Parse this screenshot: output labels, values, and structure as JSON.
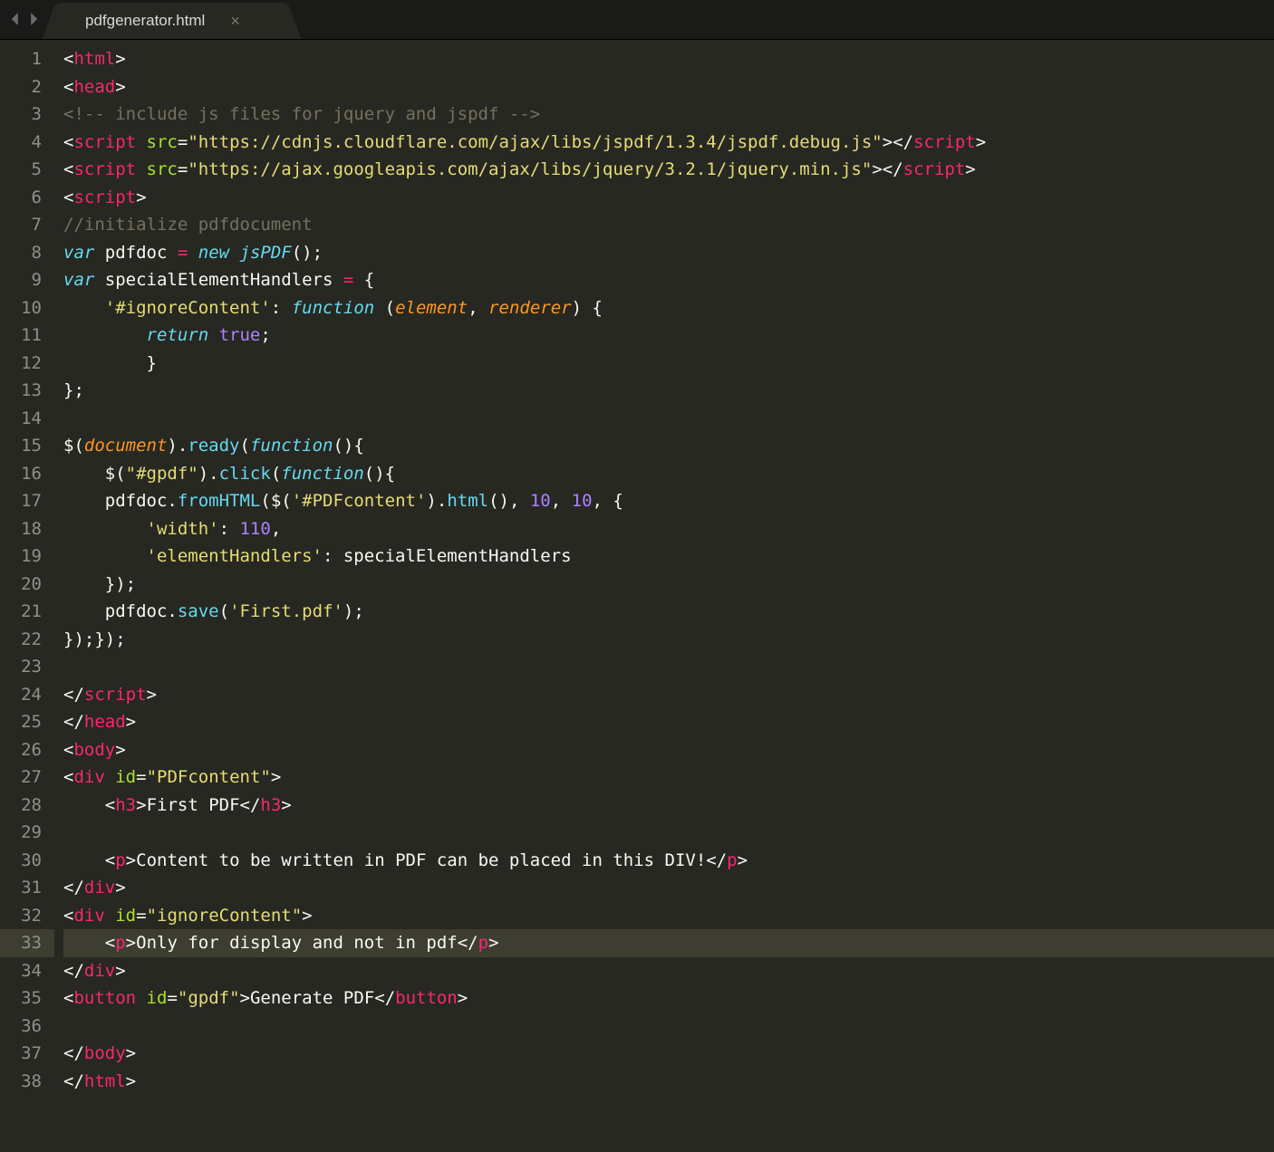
{
  "tab": {
    "filename": "pdfgenerator.html",
    "close": "×"
  },
  "nav": {
    "back": "◀",
    "forward": "▶"
  },
  "active_line": 33,
  "line_count": 38,
  "code": {
    "l1": [
      [
        "tagp",
        "<"
      ],
      [
        "tag",
        "html"
      ],
      [
        "tagp",
        ">"
      ]
    ],
    "l2": [
      [
        "tagp",
        "<"
      ],
      [
        "tag",
        "head"
      ],
      [
        "tagp",
        ">"
      ]
    ],
    "l3": [
      [
        "cmt",
        "<!-- include js files for jquery and jspdf -->"
      ]
    ],
    "l4": [
      [
        "tagp",
        "<"
      ],
      [
        "tag",
        "script"
      ],
      [
        "txt",
        " "
      ],
      [
        "attr",
        "src"
      ],
      [
        "pun",
        "="
      ],
      [
        "str",
        "\"https://cdnjs.cloudflare.com/ajax/libs/jspdf/1.3.4/jspdf.debug.js\""
      ],
      [
        "tagp",
        "></"
      ],
      [
        "tag",
        "script"
      ],
      [
        "tagp",
        ">"
      ]
    ],
    "l5": [
      [
        "tagp",
        "<"
      ],
      [
        "tag",
        "script"
      ],
      [
        "txt",
        " "
      ],
      [
        "attr",
        "src"
      ],
      [
        "pun",
        "="
      ],
      [
        "str",
        "\"https://ajax.googleapis.com/ajax/libs/jquery/3.2.1/jquery.min.js\""
      ],
      [
        "tagp",
        "></"
      ],
      [
        "tag",
        "script"
      ],
      [
        "tagp",
        ">"
      ]
    ],
    "l6": [
      [
        "tagp",
        "<"
      ],
      [
        "tag",
        "script"
      ],
      [
        "tagp",
        ">"
      ]
    ],
    "l7": [
      [
        "cmt",
        "//initialize pdfdocument"
      ]
    ],
    "l8": [
      [
        "stor",
        "var"
      ],
      [
        "txt",
        " pdfdoc "
      ],
      [
        "kw",
        "="
      ],
      [
        "txt",
        " "
      ],
      [
        "stor",
        "new"
      ],
      [
        "txt",
        " "
      ],
      [
        "type",
        "jsPDF"
      ],
      [
        "pun",
        "();"
      ]
    ],
    "l9": [
      [
        "stor",
        "var"
      ],
      [
        "txt",
        " specialElementHandlers "
      ],
      [
        "kw",
        "="
      ],
      [
        "txt",
        " {"
      ]
    ],
    "l10": [
      [
        "txt",
        "    "
      ],
      [
        "str",
        "'#ignoreContent'"
      ],
      [
        "pun",
        ": "
      ],
      [
        "stor",
        "function"
      ],
      [
        "txt",
        " "
      ],
      [
        "pun",
        "("
      ],
      [
        "param",
        "element"
      ],
      [
        "pun",
        ", "
      ],
      [
        "param",
        "renderer"
      ],
      [
        "pun",
        ")"
      ],
      [
        "txt",
        " {"
      ]
    ],
    "l11": [
      [
        "txt",
        "        "
      ],
      [
        "stor",
        "return"
      ],
      [
        "txt",
        " "
      ],
      [
        "bool",
        "true"
      ],
      [
        "pun",
        ";"
      ]
    ],
    "l12": [
      [
        "txt",
        "        }"
      ]
    ],
    "l13": [
      [
        "txt",
        "};"
      ]
    ],
    "l14": [],
    "l15": [
      [
        "txt",
        "$("
      ],
      [
        "param",
        "document"
      ],
      [
        "txt",
        ")."
      ],
      [
        "call",
        "ready"
      ],
      [
        "pun",
        "("
      ],
      [
        "stor",
        "function"
      ],
      [
        "pun",
        "(){"
      ]
    ],
    "l16": [
      [
        "txt",
        "    $("
      ],
      [
        "str",
        "\"#gpdf\""
      ],
      [
        "txt",
        ")."
      ],
      [
        "call",
        "click"
      ],
      [
        "pun",
        "("
      ],
      [
        "stor",
        "function"
      ],
      [
        "pun",
        "(){"
      ]
    ],
    "l17": [
      [
        "txt",
        "    pdfdoc."
      ],
      [
        "call",
        "fromHTML"
      ],
      [
        "pun",
        "("
      ],
      [
        "txt",
        "$("
      ],
      [
        "str",
        "'#PDFcontent'"
      ],
      [
        "txt",
        ")."
      ],
      [
        "call",
        "html"
      ],
      [
        "pun",
        "(), "
      ],
      [
        "num",
        "10"
      ],
      [
        "pun",
        ", "
      ],
      [
        "num",
        "10"
      ],
      [
        "pun",
        ", {"
      ]
    ],
    "l18": [
      [
        "txt",
        "        "
      ],
      [
        "str",
        "'width'"
      ],
      [
        "pun",
        ": "
      ],
      [
        "num",
        "110"
      ],
      [
        "pun",
        ","
      ]
    ],
    "l19": [
      [
        "txt",
        "        "
      ],
      [
        "str",
        "'elementHandlers'"
      ],
      [
        "pun",
        ": specialElementHandlers"
      ]
    ],
    "l20": [
      [
        "txt",
        "    });"
      ]
    ],
    "l21": [
      [
        "txt",
        "    pdfdoc."
      ],
      [
        "call",
        "save"
      ],
      [
        "pun",
        "("
      ],
      [
        "str",
        "'First.pdf'"
      ],
      [
        "pun",
        ");"
      ]
    ],
    "l22": [
      [
        "txt",
        "});});"
      ]
    ],
    "l23": [],
    "l24": [
      [
        "tagp",
        "</"
      ],
      [
        "tag",
        "script"
      ],
      [
        "tagp",
        ">"
      ]
    ],
    "l25": [
      [
        "tagp",
        "</"
      ],
      [
        "tag",
        "head"
      ],
      [
        "tagp",
        ">"
      ]
    ],
    "l26": [
      [
        "tagp",
        "<"
      ],
      [
        "tag",
        "body"
      ],
      [
        "tagp",
        ">"
      ]
    ],
    "l27": [
      [
        "tagp",
        "<"
      ],
      [
        "tag",
        "div"
      ],
      [
        "txt",
        " "
      ],
      [
        "attr",
        "id"
      ],
      [
        "pun",
        "="
      ],
      [
        "str",
        "\"PDFcontent\""
      ],
      [
        "tagp",
        ">"
      ]
    ],
    "l28": [
      [
        "txt",
        "    "
      ],
      [
        "tagp",
        "<"
      ],
      [
        "tag",
        "h3"
      ],
      [
        "tagp",
        ">"
      ],
      [
        "txt",
        "First PDF"
      ],
      [
        "tagp",
        "</"
      ],
      [
        "tag",
        "h3"
      ],
      [
        "tagp",
        ">"
      ]
    ],
    "l29": [],
    "l30": [
      [
        "txt",
        "    "
      ],
      [
        "tagp",
        "<"
      ],
      [
        "tag",
        "p"
      ],
      [
        "tagp",
        ">"
      ],
      [
        "txt",
        "Content to be written in PDF can be placed in this DIV!"
      ],
      [
        "tagp",
        "</"
      ],
      [
        "tag",
        "p"
      ],
      [
        "tagp",
        ">"
      ]
    ],
    "l31": [
      [
        "tagp",
        "</"
      ],
      [
        "tag",
        "div"
      ],
      [
        "tagp",
        ">"
      ]
    ],
    "l32": [
      [
        "tagp",
        "<"
      ],
      [
        "tag",
        "div"
      ],
      [
        "txt",
        " "
      ],
      [
        "attr",
        "id"
      ],
      [
        "pun",
        "="
      ],
      [
        "str",
        "\"ignoreContent\""
      ],
      [
        "tagp",
        ">"
      ]
    ],
    "l33": [
      [
        "txt",
        "    "
      ],
      [
        "tagp",
        "<"
      ],
      [
        "tag",
        "p"
      ],
      [
        "tagp",
        ">"
      ],
      [
        "txt",
        "Only for display and not in pdf"
      ],
      [
        "tagp",
        "</"
      ],
      [
        "tag",
        "p"
      ],
      [
        "tagp",
        ">"
      ]
    ],
    "l34": [
      [
        "tagp",
        "</"
      ],
      [
        "tag",
        "div"
      ],
      [
        "tagp",
        ">"
      ]
    ],
    "l35": [
      [
        "tagp",
        "<"
      ],
      [
        "tag",
        "button"
      ],
      [
        "txt",
        " "
      ],
      [
        "attr",
        "id"
      ],
      [
        "pun",
        "="
      ],
      [
        "str",
        "\"gpdf\""
      ],
      [
        "tagp",
        ">"
      ],
      [
        "txt",
        "Generate PDF"
      ],
      [
        "tagp",
        "</"
      ],
      [
        "tag",
        "button"
      ],
      [
        "tagp",
        ">"
      ]
    ],
    "l36": [],
    "l37": [
      [
        "tagp",
        "</"
      ],
      [
        "tag",
        "body"
      ],
      [
        "tagp",
        ">"
      ]
    ],
    "l38": [
      [
        "tagp",
        "</"
      ],
      [
        "tag",
        "html"
      ],
      [
        "tagp",
        ">"
      ]
    ]
  }
}
